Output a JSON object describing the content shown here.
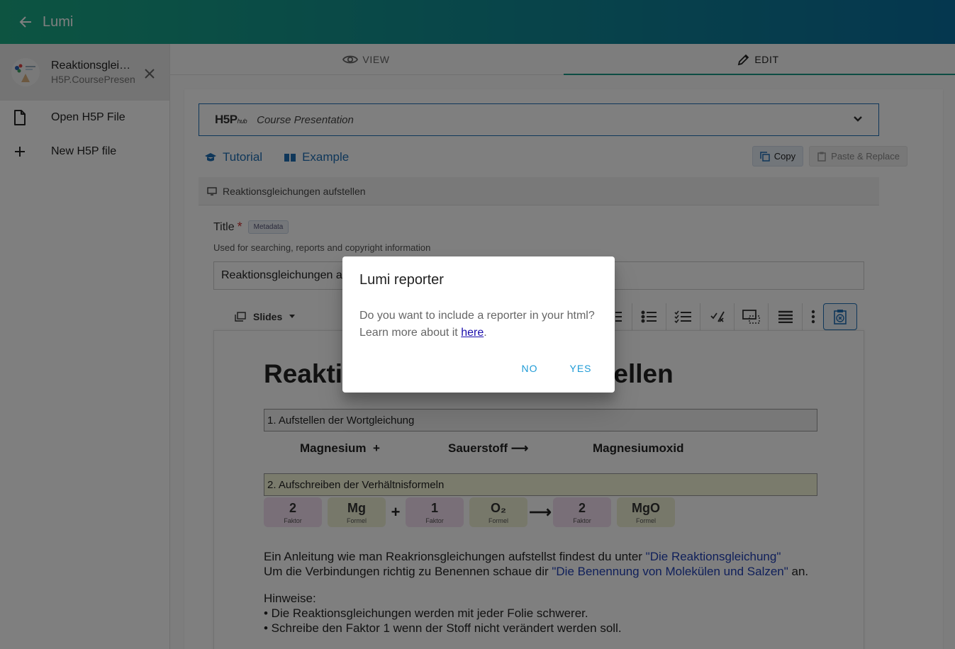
{
  "app": {
    "title": "Lumi"
  },
  "sidebar": {
    "file": {
      "name": "Reaktionsgleic…",
      "type": "H5P.CoursePresen"
    },
    "actions": [
      {
        "label": "Open H5P File",
        "icon": "file-icon"
      },
      {
        "label": "New H5P file",
        "icon": "plus-icon"
      }
    ]
  },
  "tabs": [
    {
      "label": "VIEW",
      "icon": "eye-icon",
      "active": false
    },
    {
      "label": "EDIT",
      "icon": "pencil-icon",
      "active": true
    }
  ],
  "editor": {
    "hub_logo": "H5P",
    "hub_logo_sub": "hub",
    "content_type": "Course Presentation",
    "links": {
      "tutorial": "Tutorial",
      "example": "Example"
    },
    "buttons": {
      "copy": "Copy",
      "paste": "Paste & Replace"
    },
    "section_title": "Reaktionsgleichungen aufstellen",
    "field": {
      "label": "Title",
      "required_mark": "*",
      "metadata": "Metadata",
      "description": "Used for searching, reports and copyright information",
      "value": "Reaktionsgleichungen aufstellen"
    },
    "slides_label": "Slides"
  },
  "slide": {
    "title": "Reaktionsgleichungen aufstellen",
    "step1": "1. Aufstellen der Wortgleichung",
    "word_eq": {
      "a": "Magnesium",
      "plus": "+",
      "b": "Sauerstoff",
      "arrow": "⟶",
      "c": "Magnesiumoxid"
    },
    "step2": "2. Aufschreiben der Verhältnisformeln",
    "boxes": [
      {
        "value": "2",
        "caption": "Faktor"
      },
      {
        "value": "Mg",
        "caption": "Formel"
      },
      {
        "value": "1",
        "caption": "Faktor"
      },
      {
        "value": "O₂",
        "caption": "Formel"
      },
      {
        "value": "2",
        "caption": "Faktor"
      },
      {
        "value": "MgO",
        "caption": "Formel"
      }
    ],
    "ops": {
      "plus": "+",
      "arrow": "⟶"
    },
    "line1_text": "Ein Anleitung wie man Reakrionsgleichungen aufstellst findest du unter ",
    "line1_link": "\"Die Reaktionsgleichung\"",
    "line2_text": "Um die Verbindungen richtig zu Benennen schaue dir  ",
    "line2_link": "\"Die Benennung von Molekülen und Salzen\"",
    "line2_end": " an.",
    "hint_title": "Hinweise:",
    "hint1": "• Die Reaktionsgleichungen werden mit jeder Folie schwerer.",
    "hint2": "• Schreibe den Faktor 1 wenn der Stoff nicht verändert werden soll."
  },
  "dialog": {
    "title": "Lumi reporter",
    "body_line1": "Do you want to include a reporter in your html?",
    "body_line2_prefix": "Learn more about it ",
    "body_link": "here",
    "body_line2_suffix": ".",
    "no_label": "NO",
    "yes_label": "YES"
  },
  "colors": {
    "appbar_start": "#1aa883",
    "appbar_end": "#0a6e9e",
    "accent": "#1a9a86",
    "dialog_button": "#1f9bd6",
    "link": "#1f6fb5"
  }
}
